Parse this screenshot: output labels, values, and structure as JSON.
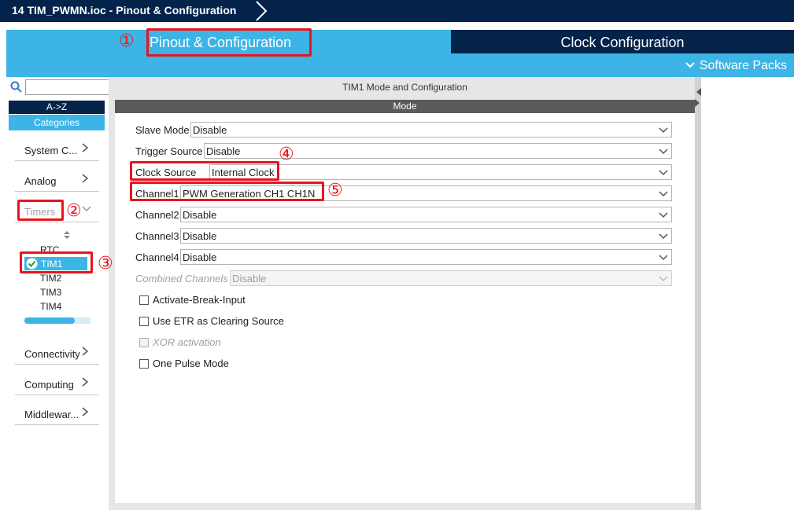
{
  "window": {
    "title": "14 TIM_PWMN.ioc - Pinout & Configuration"
  },
  "tabs": {
    "pinout": "Pinout & Configuration",
    "clock": "Clock Configuration",
    "software_packs": "Software Packs"
  },
  "sidebar": {
    "search_value": "",
    "az_label": "A->Z",
    "categories_label": "Categories",
    "categories": [
      "System C...",
      "Analog",
      "Timers",
      "Connectivity",
      "Computing",
      "Middlewar..."
    ],
    "timers": [
      "RTC",
      "TIM1",
      "TIM2",
      "TIM3",
      "TIM4"
    ]
  },
  "main": {
    "title": "TIM1 Mode and Configuration",
    "mode_header": "Mode",
    "fields": [
      {
        "label": "Slave Mode",
        "value": "Disable"
      },
      {
        "label": "Trigger Source",
        "value": "Disable"
      },
      {
        "label": "Clock Source",
        "value": "Internal Clock"
      },
      {
        "label": "Channel1",
        "value": "PWM Generation CH1 CH1N"
      },
      {
        "label": "Channel2",
        "value": "Disable"
      },
      {
        "label": "Channel3",
        "value": "Disable"
      },
      {
        "label": "Channel4",
        "value": "Disable"
      },
      {
        "label": "Combined Channels",
        "value": "Disable"
      }
    ],
    "checkboxes": [
      {
        "label": "Activate-Break-Input"
      },
      {
        "label": "Use ETR as Clearing Source"
      },
      {
        "label": "XOR activation"
      },
      {
        "label": "One Pulse Mode"
      }
    ]
  },
  "annotations": [
    "①",
    "②",
    "③",
    "④",
    "⑤"
  ],
  "colors": {
    "navy": "#03234b",
    "accent": "#3cb4e6",
    "highlight": "#e8141e"
  }
}
